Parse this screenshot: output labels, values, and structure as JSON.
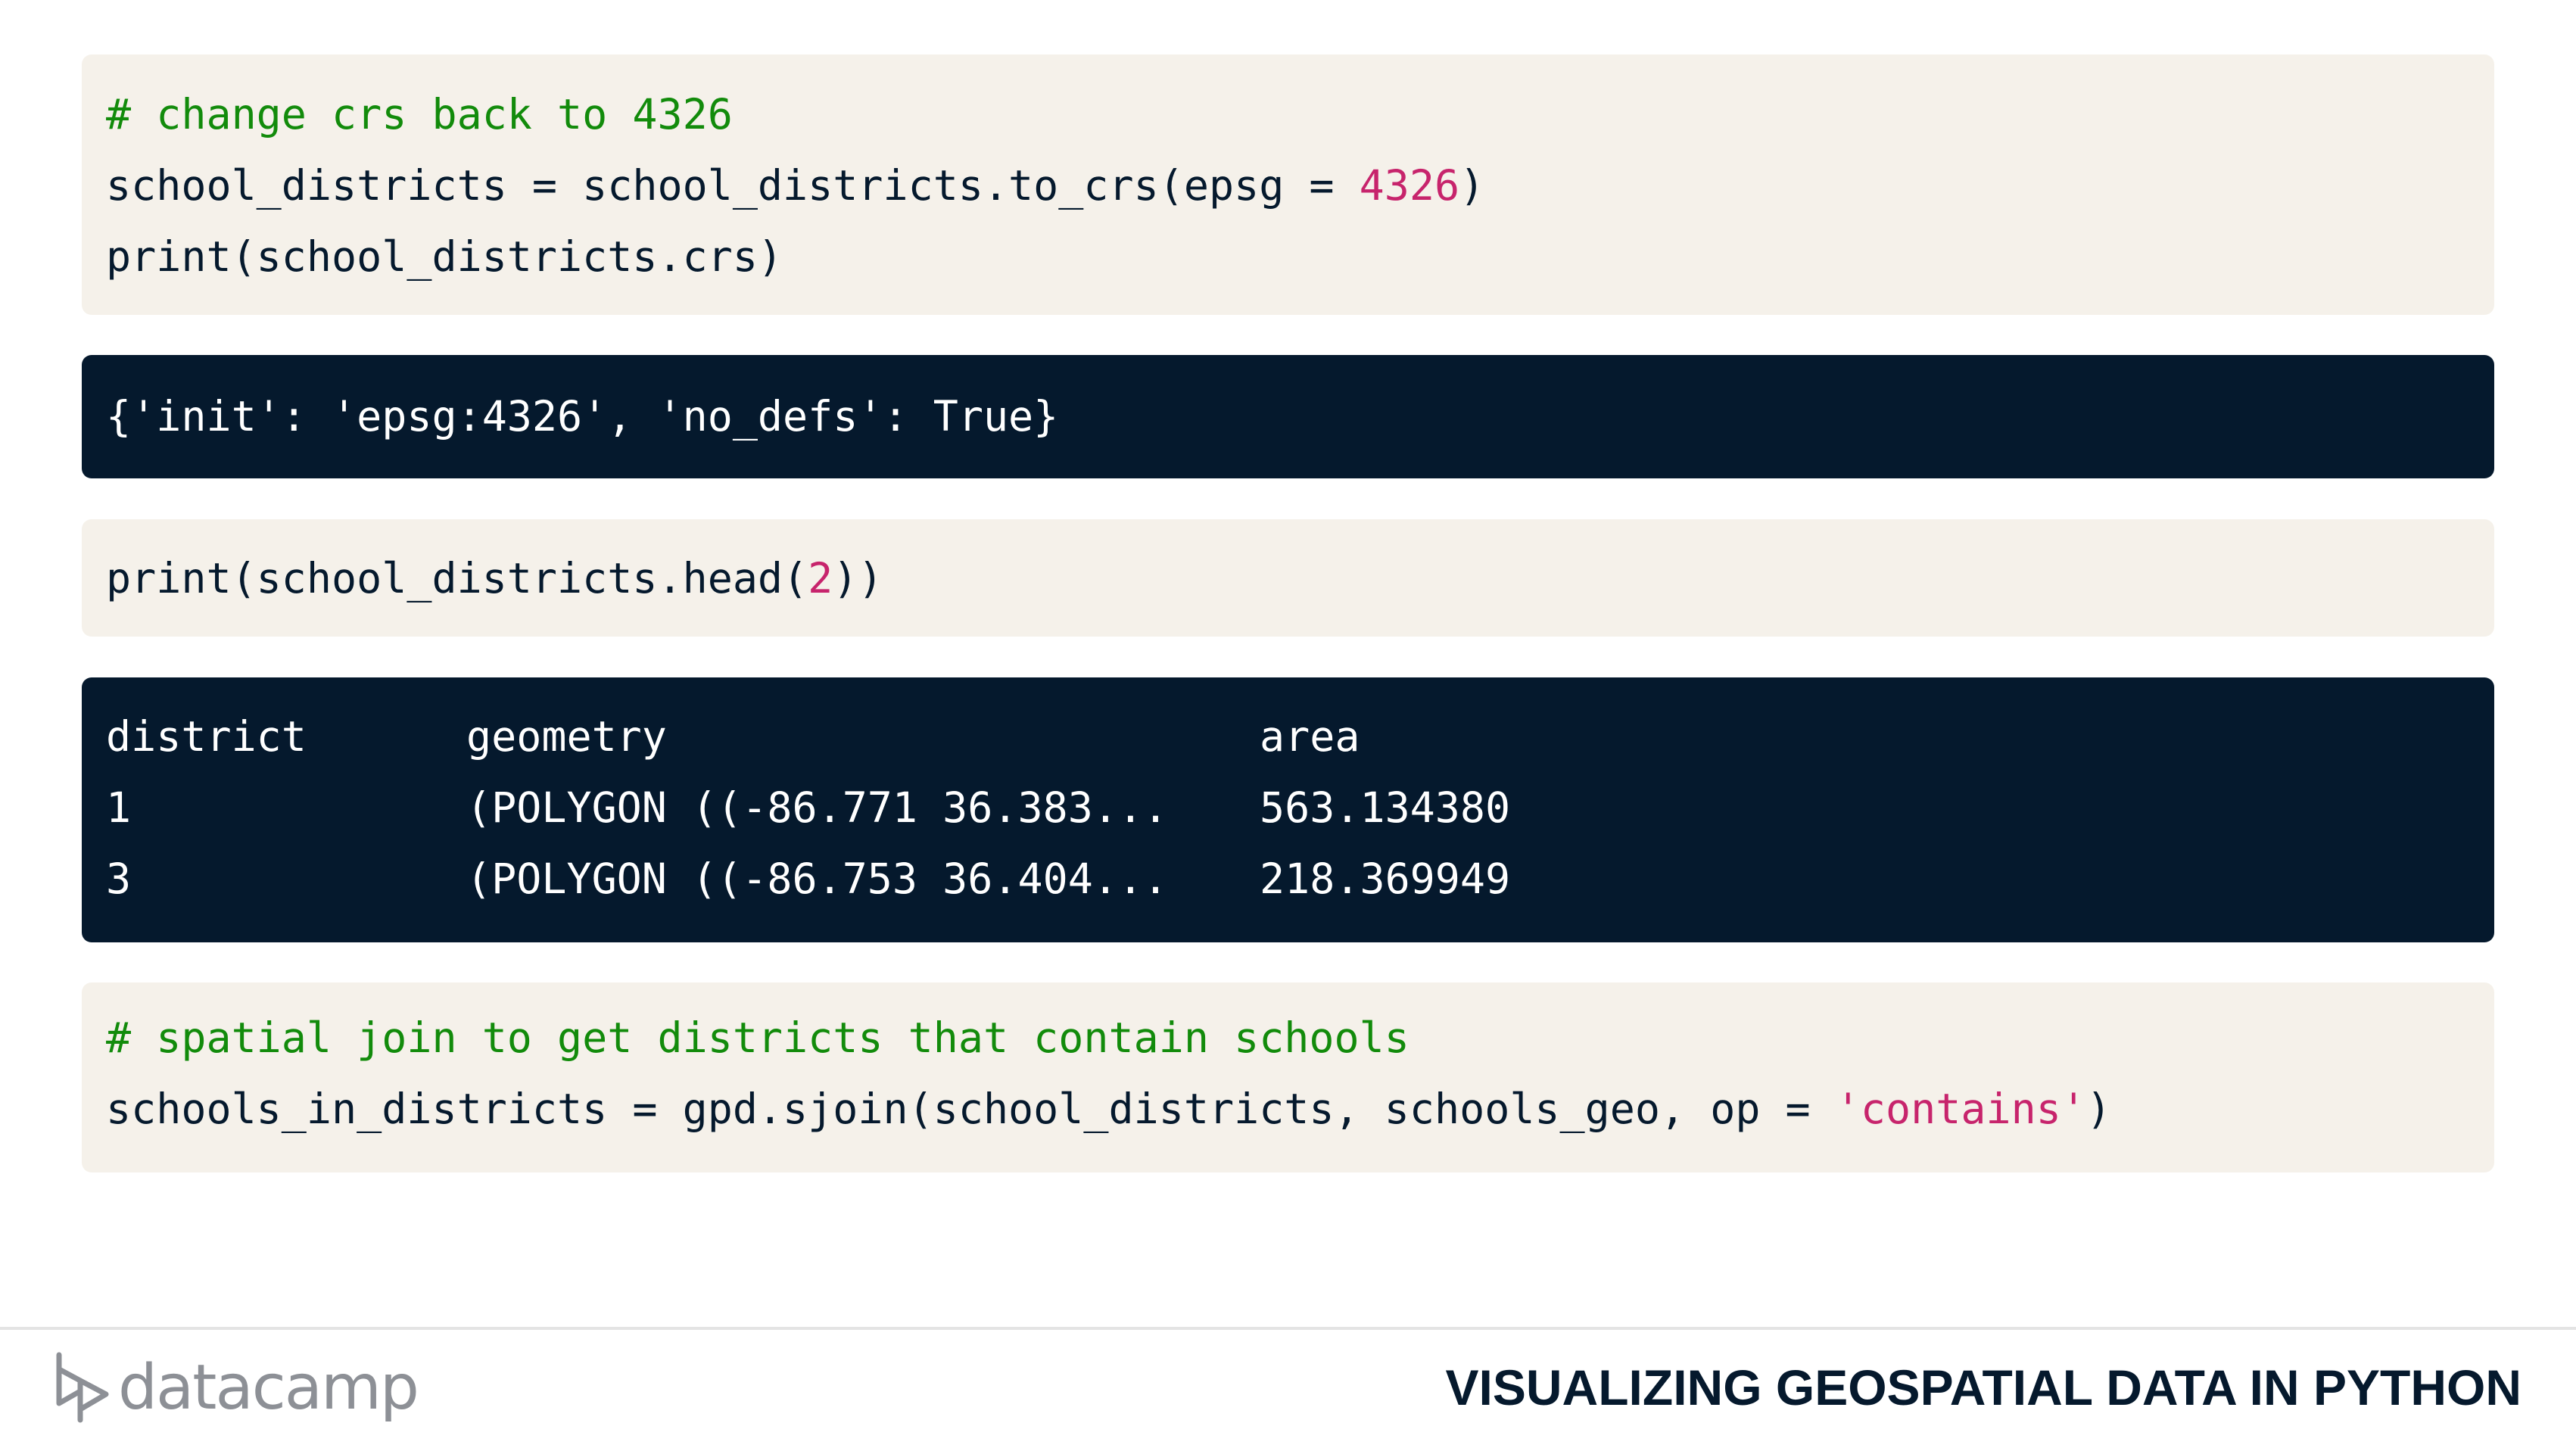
{
  "code_block_1": {
    "comment": "# change crs back to 4326",
    "line2_pre": "school_districts = school_districts.to_crs(epsg = ",
    "line2_num": "4326",
    "line2_post": ")",
    "line3": "print(school_districts.crs)"
  },
  "output_block_1": {
    "text": "{'init': 'epsg:4326', 'no_defs': True}"
  },
  "code_block_2": {
    "pre": "print(school_districts.head(",
    "num": "2",
    "post": "))"
  },
  "output_block_2": {
    "headers": [
      "district",
      "geometry",
      "area"
    ],
    "rows": [
      [
        "1",
        "(POLYGON ((-86.771 36.383...",
        "563.134380"
      ],
      [
        "3",
        "(POLYGON ((-86.753 36.404...",
        "218.369949"
      ]
    ]
  },
  "code_block_3": {
    "comment": "# spatial join to get districts that contain schools",
    "line2_pre": "schools_in_districts = gpd.sjoin(school_districts, schools_geo, op = ",
    "line2_str": "'contains'",
    "line2_post": ")"
  },
  "footer": {
    "logo_text": "datacamp",
    "course_title": "VISUALIZING GEOSPATIAL DATA IN PYTHON"
  },
  "colors": {
    "code_bg": "#f5f1ea",
    "output_bg": "#05192d",
    "comment": "#128b0b",
    "literal": "#c7246c",
    "navy": "#05192d"
  }
}
